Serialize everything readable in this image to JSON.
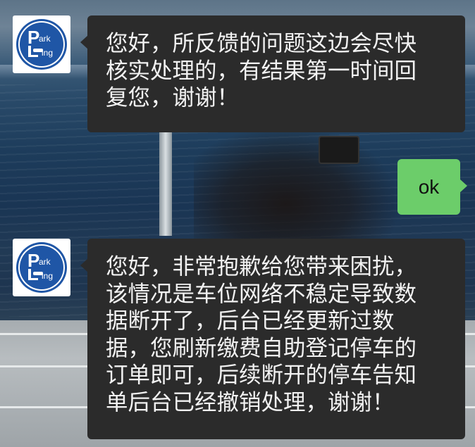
{
  "chat": {
    "contact_avatar": {
      "logo_text": "Park Ling"
    },
    "messages": [
      {
        "from": "contact",
        "lines": [
          "您好，所反馈的问题这边会尽快",
          "核实处理的，有结果第一时间回",
          "复您，谢谢！"
        ]
      },
      {
        "from": "me",
        "text": "ok"
      },
      {
        "from": "contact",
        "lines": [
          "您好，非常抱歉给您带来困扰，",
          "该情况是车位网络不稳定导致数",
          "据断开了，后台已经更新过数",
          "据，您刷新缴费自助登记停车的",
          "订单即可，后续断开的停车告知",
          "单后台已经撤销处理，谢谢！"
        ]
      }
    ]
  },
  "colors": {
    "bubble_received": "#2b2b2b",
    "bubble_sent": "#6ccd6a",
    "logo_blue": "#1f56a6"
  }
}
